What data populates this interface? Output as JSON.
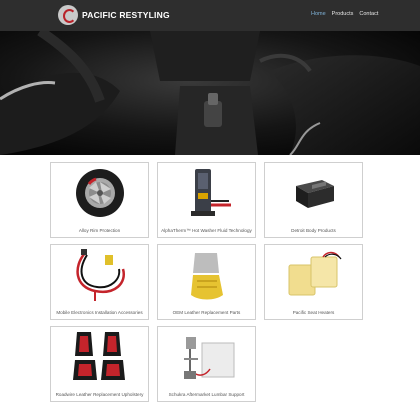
{
  "header": {
    "logo_text": "PACIFIC RESTYLING",
    "nav": [
      {
        "label": "Home",
        "active": true
      },
      {
        "label": "Products",
        "active": false
      },
      {
        "label": "Contact",
        "active": false
      }
    ]
  },
  "products": [
    {
      "label": "Alloy Rim Protection",
      "icon": "tire-image"
    },
    {
      "label": "AlphaTherm™ Hot Washer Fluid Technology",
      "icon": "washer-fluid-module-image"
    },
    {
      "label": "Detroit Body Products",
      "icon": "boxed-module-image"
    },
    {
      "label": "Mobile Electronics Installation Accessories",
      "icon": "wiring-harness-image"
    },
    {
      "label": "OEM Leather Replacement Parts",
      "icon": "seat-cover-part-image"
    },
    {
      "label": "Pacific Seat Heaters",
      "icon": "seat-heater-pads-image"
    },
    {
      "label": "Roadwire Leather Replacement Upholstery",
      "icon": "red-black-seats-image"
    },
    {
      "label": "Schukra Aftermarket Lumbar Support",
      "icon": "lumbar-support-kit-image"
    }
  ],
  "colors": {
    "topbar": "#2e2e2e",
    "nav_active": "#7fb2d8",
    "accent_red": "#c4242b"
  }
}
